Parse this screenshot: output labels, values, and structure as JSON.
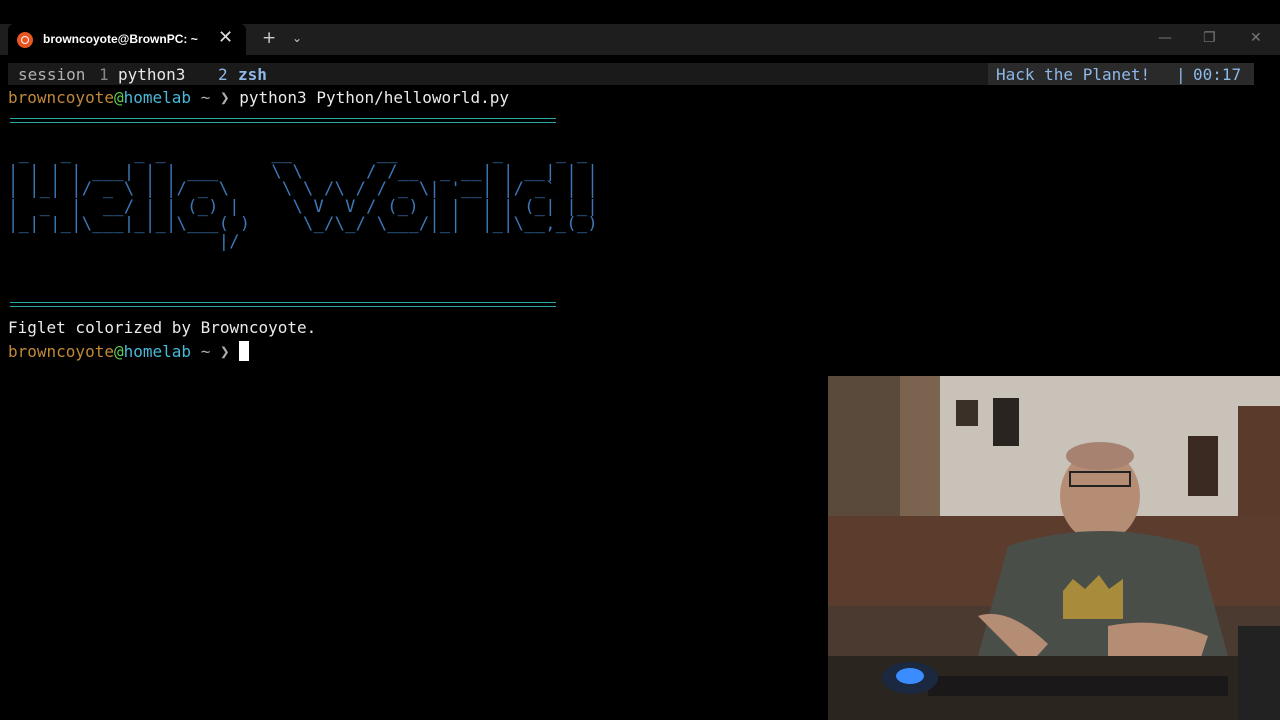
{
  "window": {
    "tab_title": "browncoyote@BrownPC: ~",
    "tab_icon": "ubuntu-icon",
    "close_glyph": "✕",
    "new_tab_glyph": "+",
    "dropdown_glyph": "⌄",
    "minimize_glyph": "—",
    "maximize_glyph": "❐",
    "window_close_glyph": "✕"
  },
  "tmux": {
    "session_label": "session",
    "window1_index": "1",
    "window1_name": "python3",
    "window2_index": "2",
    "window2_name": "zsh",
    "right_message": "Hack the Planet!",
    "separator": "|",
    "clock": "00:17"
  },
  "prompt": {
    "user": "browncoyote",
    "at": "@",
    "host": "homelab",
    "path": "~",
    "symbol": "❯"
  },
  "terminal": {
    "command": "python3 Python/helloworld.py",
    "figlet_art": " _   _      _ _          __        __         _     _ _ \n| | | | ___| | | ___     \\ \\      / /__  _ __| | __| | |\n| |_| |/ _ \\ | |/ _ \\     \\ \\ /\\ / / _ \\| '__| |/ _` | |\n|  _  |  __/ | | (_) |     \\ V  V / (_) | |  | | (_| |_|\n|_| |_|\\___|_|_|\\___( )     \\_/\\_/ \\___/|_|  |_|\\__,_(_)\n                    |/                                  ",
    "output_line": "Figlet colorized by Browncoyote."
  },
  "colors": {
    "user": "#c0893a",
    "at": "#5ecf4f",
    "host": "#4ab8d8",
    "figlet": "#3c78b8",
    "rule": "#2fa8a4",
    "tmux_accent": "#8fb8e8"
  }
}
